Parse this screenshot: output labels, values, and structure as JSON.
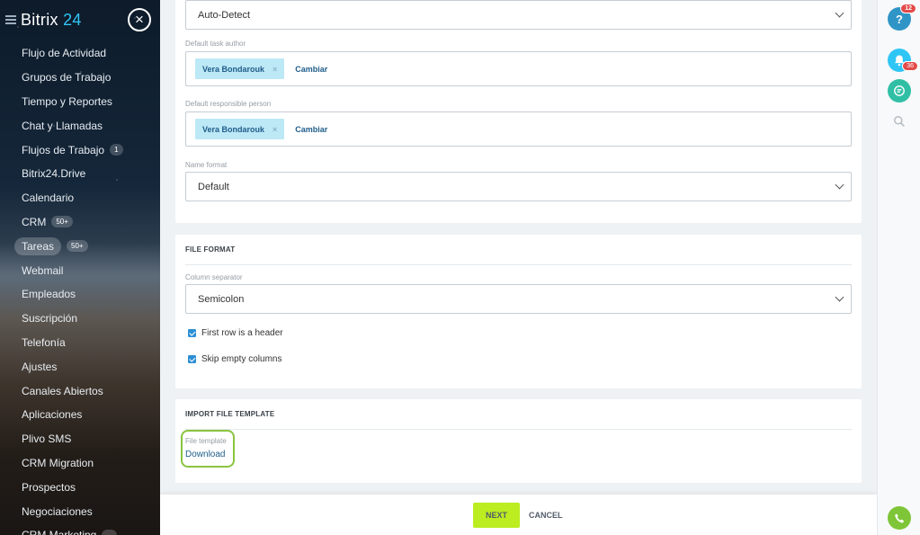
{
  "sidebar": {
    "logo_text": "Bitrix",
    "logo_num": "24",
    "close_glyph": "×",
    "items": [
      {
        "label": "Flujo de Actividad",
        "badge": ""
      },
      {
        "label": "Grupos de Trabajo",
        "badge": ""
      },
      {
        "label": "Tiempo y Reportes",
        "badge": ""
      },
      {
        "label": "Chat y Llamadas",
        "badge": ""
      },
      {
        "label": "Flujos de Trabajo",
        "badge": "1"
      },
      {
        "label": "Bitrix24.Drive",
        "badge": ""
      },
      {
        "label": "Calendario",
        "badge": ""
      },
      {
        "label": "CRM",
        "badge": "50+"
      },
      {
        "label": "Tareas",
        "badge": "50+",
        "active": true
      },
      {
        "label": "Webmail",
        "badge": ""
      },
      {
        "label": "Empleados",
        "badge": ""
      },
      {
        "label": "Suscripción",
        "badge": ""
      },
      {
        "label": "Telefonía",
        "badge": ""
      },
      {
        "label": "Ajustes",
        "badge": ""
      },
      {
        "label": "Canales Abiertos",
        "badge": ""
      },
      {
        "label": "Aplicaciones",
        "badge": ""
      },
      {
        "label": "Plivo SMS",
        "badge": ""
      },
      {
        "label": "CRM Migration",
        "badge": ""
      },
      {
        "label": "Prospectos",
        "badge": ""
      },
      {
        "label": "Negociaciones",
        "badge": ""
      },
      {
        "label": "CRM Marketing",
        "badge": "..."
      }
    ]
  },
  "settings": {
    "encoding_value": "Auto-Detect",
    "author_label": "Default task author",
    "author_name": "Vera Bondarouk",
    "change_label": "Cambiar",
    "responsible_label": "Default responsible person",
    "responsible_name": "Vera Bondarouk",
    "name_format_label": "Name format",
    "name_format_value": "Default",
    "remove_glyph": "×"
  },
  "file_format": {
    "title": "FILE FORMAT",
    "separator_label": "Column separator",
    "separator_value": "Semicolon",
    "first_row_header": "First row is a header",
    "skip_empty": "Skip empty columns"
  },
  "template": {
    "title": "IMPORT FILE TEMPLATE",
    "file_template_label": "File template",
    "download_label": "Download"
  },
  "footer": {
    "next_label": "NEXT",
    "cancel_label": "CANCEL"
  },
  "rightbar": {
    "help_glyph": "?",
    "help_count": "12",
    "notify_count": "36"
  },
  "icons": {
    "menu": "hamburger-icon",
    "close": "close-icon",
    "help": "help-icon",
    "bell": "bell-icon",
    "chat": "chat-icon",
    "search": "search-icon",
    "phone": "phone-icon",
    "chevron": "chevron-down-icon",
    "check": "checkbox-checked-icon"
  },
  "colors": {
    "accent": "#2fc6f6",
    "next_button": "#bbed21",
    "checkbox": "#2d8fd5",
    "tag_bg": "#bde8f6",
    "highlight_outline": "#8ac43f"
  }
}
